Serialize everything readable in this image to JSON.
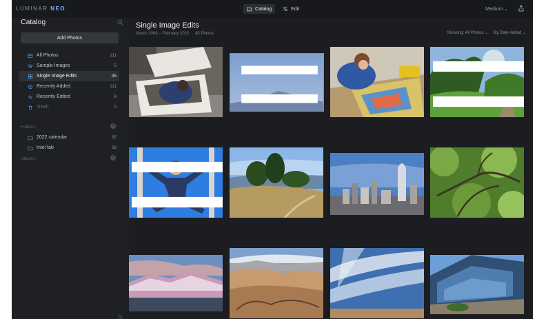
{
  "app": {
    "logo_main": "LUMINAR",
    "logo_accent": "NEO",
    "modes": [
      {
        "label": "Catalog",
        "icon": "folder-icon",
        "active": true
      },
      {
        "label": "Edit",
        "icon": "sliders-icon",
        "active": false
      }
    ],
    "thumb_size": "Medium ⌄"
  },
  "sidebar": {
    "title": "Catalog",
    "add_button": "Add Photos",
    "items": [
      {
        "label": "All Photos",
        "count": "111",
        "icon": "photos-icon"
      },
      {
        "label": "Sample Images",
        "count": "5",
        "icon": "graduation-cap-icon"
      },
      {
        "label": "Single Image Edits",
        "count": "45",
        "icon": "grid-icon",
        "selected": true
      },
      {
        "label": "Recently Added",
        "count": "111",
        "icon": "plus-circle-icon"
      },
      {
        "label": "Recently Edited",
        "count": "8",
        "icon": "sliders-icon"
      },
      {
        "label": "Trash",
        "count": "0",
        "icon": "trash-icon"
      }
    ],
    "folders_label": "Folders",
    "folders": [
      {
        "label": "2022 calendar",
        "count": "35",
        "icon": "folder-icon"
      },
      {
        "label": "Intel fab",
        "count": "26",
        "icon": "folder-icon"
      }
    ],
    "albums_label": "Albums"
  },
  "main": {
    "title": "Single Image Edits",
    "date_range": "March 2008 – February 2022",
    "photo_count": "45 Photos",
    "showing": "Showing: All Photos ⌄",
    "sort": "By Date Added ⌄"
  },
  "colors": {
    "accent": "#4aa3e6",
    "background": "#1b1d20",
    "sidebar": "#1e2023"
  }
}
